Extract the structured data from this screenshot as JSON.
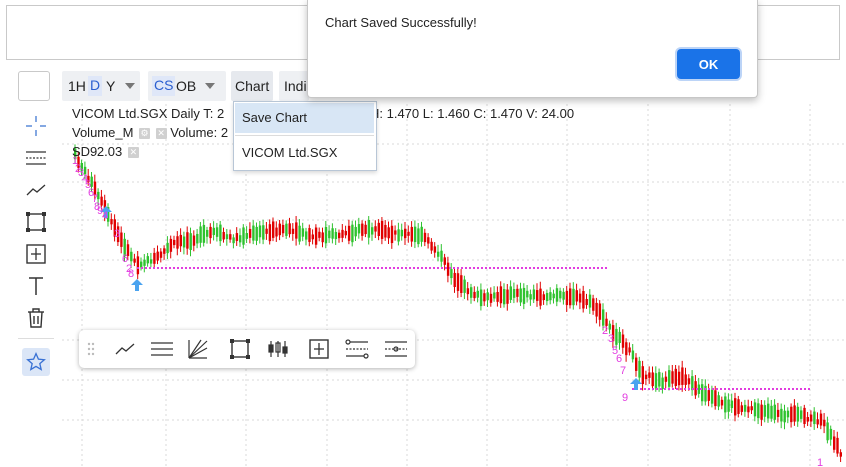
{
  "toolbar": {
    "timeframes": [
      "1H",
      "D",
      "Y"
    ],
    "selected_timeframe": "D",
    "chart_type": "CS",
    "overlay": "OB",
    "chart_menu": "Chart",
    "indicators_menu": "Indi"
  },
  "chart": {
    "symbol_line": "VICOM Ltd.SGX Daily  T: 2",
    "ohlc_line": "H: 1.470   L: 1.460   C: 1.470   V: 24.00",
    "volume_label": "Volume_M",
    "volume_value": "Volume: 2",
    "sd_label": "SD9",
    "sd_value": "2.03",
    "colors": {
      "up": "#2ec22e",
      "down": "#e00000",
      "marker": "#e23ce0",
      "arrow": "#4aa3ef",
      "grid": "#d8d8d8"
    },
    "pattern_labels": [
      "1",
      "2",
      "3",
      "4",
      "5",
      "6",
      "7",
      "8",
      "9",
      "4",
      "3",
      "6",
      "2",
      "8",
      "2",
      "3",
      "5",
      "6",
      "7",
      "9"
    ],
    "tail_label": "1"
  },
  "chart_menu_dropdown": {
    "items": [
      "Save Chart",
      "VICOM Ltd.SGX"
    ],
    "highlighted": "Save Chart"
  },
  "dialog": {
    "message": "Chart Saved Successfully!",
    "ok_label": "OK"
  },
  "sidebar": {
    "icons": [
      "crosshair-icon",
      "horizontal-lines-icon",
      "trend-line-icon",
      "rectangle-icon",
      "measure-icon",
      "text-icon",
      "trash-icon",
      "star-icon"
    ]
  },
  "drawing_toolbar": {
    "icons": [
      "drag-handle-icon",
      "trend-line-icon",
      "horizontal-lines-icon",
      "fib-fan-icon",
      "rectangle-icon",
      "candles-icon",
      "measure-icon",
      "fib-retracement-icon",
      "range-icon"
    ]
  }
}
